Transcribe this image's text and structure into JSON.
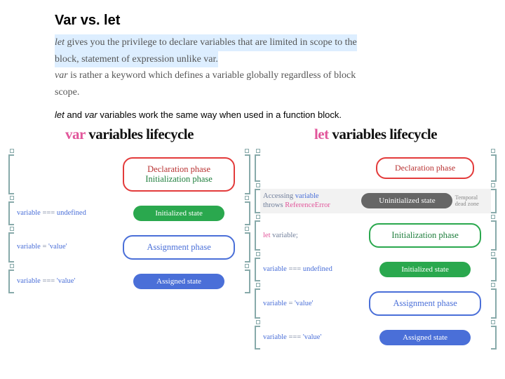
{
  "title": "Var vs. let",
  "intro": {
    "l1a": "let",
    "l1b": " gives you the privilege to declare variables that are limited in scope to the",
    "l2": "block, statement of expression unlike var.",
    "l3a": "var",
    "l3b": " is rather a keyword which defines a variable globally regardless of block",
    "l4": "scope."
  },
  "subnote": {
    "let": "let",
    "and": " and ",
    "var": "var",
    "rest": " variables work the same way when used in a function block."
  },
  "varcol": {
    "title_kw": "var",
    "title_rest": " variables lifecycle",
    "decl": "Declaration phase",
    "init": "Initialization phase",
    "state_init": "Initialized state",
    "assign": "Assignment phase",
    "state_assigned": "Assigned state",
    "l_undef_a": "variable",
    "l_undef_b": " === ",
    "l_undef_c": "undefined",
    "l_assign_a": "variable",
    "l_assign_b": " = ",
    "l_assign_c": "'value'",
    "l_eq_a": "variable",
    "l_eq_b": " === ",
    "l_eq_c": "'value'"
  },
  "letcol": {
    "title_kw": "let",
    "title_rest": " variables lifecycle",
    "decl": "Declaration phase",
    "uninit": "Uninitialized state",
    "init": "Initialization phase",
    "state_init": "Initialized state",
    "assign": "Assignment phase",
    "state_assigned": "Assigned state",
    "tdz": "Temporal dead zone",
    "acc_a": "Accessing ",
    "acc_b": "variable",
    "acc_c": "throws ",
    "acc_d": "ReferenceError",
    "letvar_a": "let",
    "letvar_b": " variable;",
    "undef_a": "variable",
    "undef_b": " === ",
    "undef_c": "undefined",
    "asg_a": "variable",
    "asg_b": " = ",
    "asg_c": "'value'",
    "eq_a": "variable",
    "eq_b": " === ",
    "eq_c": "'value'"
  }
}
